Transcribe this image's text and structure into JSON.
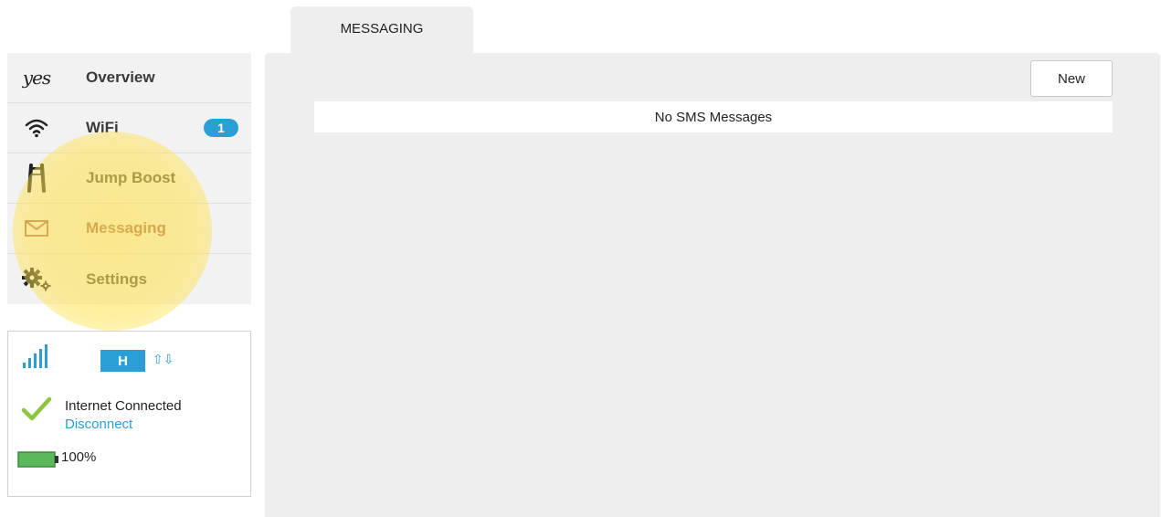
{
  "sidebar": {
    "items": [
      {
        "label": "Overview",
        "icon": "yes-logo-icon",
        "logo_text": "yes"
      },
      {
        "label": "WiFi",
        "icon": "wifi-icon",
        "badge": "1"
      },
      {
        "label": "Jump Boost",
        "icon": "jumper-cable-icon"
      },
      {
        "label": "Messaging",
        "icon": "envelope-icon",
        "active": true
      },
      {
        "label": "Settings",
        "icon": "gears-icon"
      }
    ]
  },
  "status": {
    "signal_icon": "signal-bars-icon",
    "network_type": "H",
    "transfer_icon": "up-down-arrows-icon",
    "connection_text": "Internet Connected",
    "disconnect_label": "Disconnect",
    "battery_level": "100%"
  },
  "tab": {
    "label": "MESSAGING"
  },
  "main": {
    "new_button_label": "New",
    "empty_message": "No SMS Messages"
  },
  "colors": {
    "accent_blue": "#2a9fd6",
    "active_text": "#a0524a",
    "battery_green": "#5cb85c",
    "highlight_yellow": "#ffe250"
  }
}
